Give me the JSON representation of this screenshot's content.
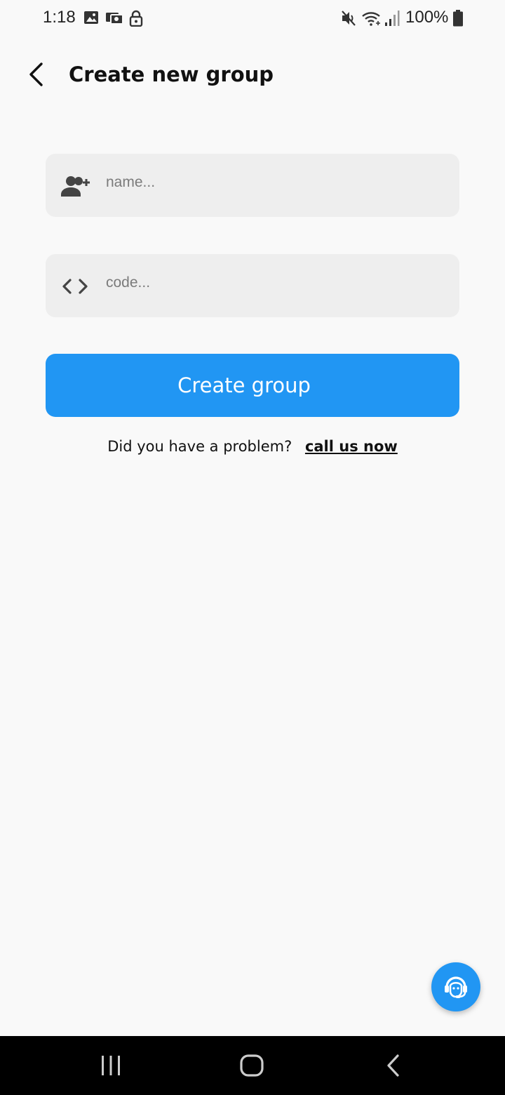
{
  "status_bar": {
    "time": "1:18",
    "battery": "100%",
    "icons": [
      "image-icon",
      "payment-icon",
      "lock-icon",
      "mute-icon",
      "wifi-icon",
      "signal-icon",
      "battery-icon"
    ]
  },
  "header": {
    "title": "Create new group",
    "back_icon": "back-arrow-icon"
  },
  "form": {
    "name_field": {
      "icon": "group-add-icon",
      "placeholder": "name...",
      "value": ""
    },
    "code_field": {
      "icon": "code-icon",
      "placeholder": "code...",
      "value": ""
    },
    "submit_label": "Create group"
  },
  "help": {
    "text": "Did you have a problem?",
    "link": "call us now"
  },
  "fab": {
    "icon": "support-agent-icon"
  },
  "nav_bar": {
    "icons": [
      "recent-apps-icon",
      "home-icon",
      "back-icon"
    ]
  },
  "colors": {
    "accent": "#2196f3",
    "background": "#f9f9f9",
    "field_background": "#eeeeee",
    "text": "#111111",
    "placeholder": "#7b7b7b"
  }
}
